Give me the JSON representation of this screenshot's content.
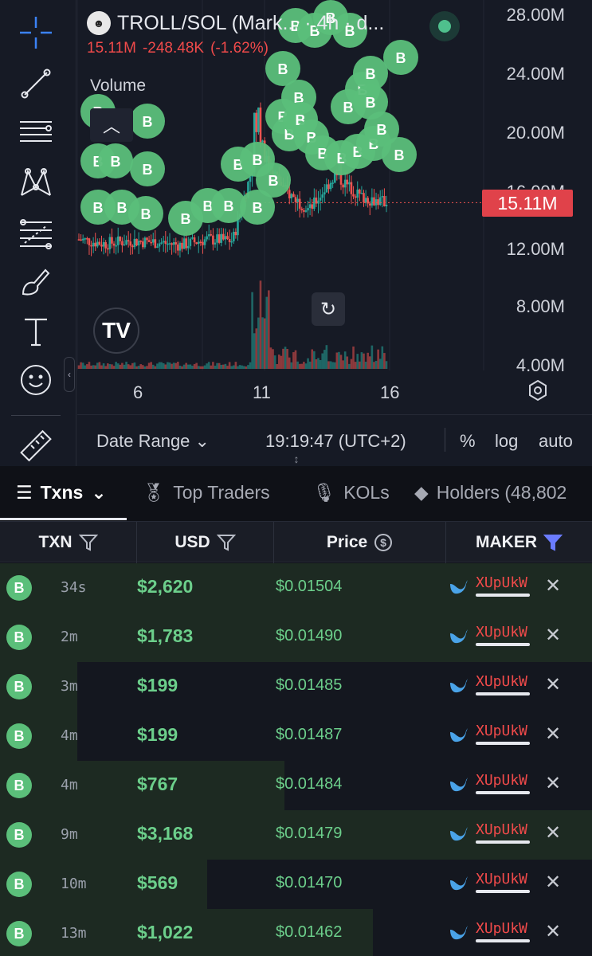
{
  "chart": {
    "pair_title": "TROLL/SOL (Mark... · 4h · d...",
    "coin_icon": "troll-face-icon",
    "last_value": "15.11M",
    "change": "-248.48K",
    "change_pct": "(-1.62%)",
    "volume_label": "Volume",
    "price_tag": "15.11M",
    "y_ticks": [
      "28.00M",
      "24.00M",
      "20.00M",
      "16.00M",
      "12.00M",
      "8.00M",
      "4.00M"
    ],
    "x_ticks": [
      "6",
      "11",
      "16"
    ],
    "bottom_bar": {
      "date_range": "Date Range",
      "clock": "19:19:47 (UTC+2)",
      "pct": "%",
      "log": "log",
      "auto": "auto"
    },
    "colors": {
      "up": "#26a69a",
      "down": "#ef5350",
      "buy_marker": "#5bbf7a",
      "price_tag": "#e0424a"
    },
    "marker_label": "B"
  },
  "chart_data": {
    "type": "candlestick",
    "title": "TROLL/SOL (Mark... · 4h · d...",
    "xlabel": "",
    "ylabel": "",
    "ylim": [
      4000000,
      28000000
    ],
    "x_ticks": [
      "6",
      "11",
      "16"
    ],
    "last": 15110000,
    "approx_series": [
      {
        "x": "4",
        "close": 12600000
      },
      {
        "x": "5",
        "close": 12300000
      },
      {
        "x": "6",
        "close": 12500000
      },
      {
        "x": "7",
        "close": 12400000
      },
      {
        "x": "8",
        "close": 12200000
      },
      {
        "x": "9",
        "close": 12600000
      },
      {
        "x": "10",
        "close": 12500000
      },
      {
        "x": "11",
        "close": 19000000
      },
      {
        "x": "12",
        "close": 16000000
      },
      {
        "x": "13",
        "close": 14600000
      },
      {
        "x": "14",
        "close": 17000000
      },
      {
        "x": "15",
        "close": 15500000
      },
      {
        "x": "16",
        "close": 15110000
      }
    ]
  },
  "tabs": [
    {
      "label": "Txns",
      "icon": "list-icon",
      "active": true
    },
    {
      "label": "Top Traders",
      "icon": "medal-icon",
      "active": false
    },
    {
      "label": "KOLs",
      "icon": "microphone-icon",
      "active": false
    },
    {
      "label": "Holders (48,802",
      "icon": "diamond-icon",
      "active": false
    }
  ],
  "table": {
    "headers": {
      "txn": "TXN",
      "usd": "USD",
      "price": "Price",
      "maker": "MAKER"
    },
    "rows": [
      {
        "type": "B",
        "age": "34s",
        "usd": "$2,620",
        "price": "$0.01504",
        "maker": "XUpUkW",
        "fill": 1.0
      },
      {
        "type": "B",
        "age": "2m",
        "usd": "$1,783",
        "price": "$0.01490",
        "maker": "XUpUkW",
        "fill": 1.0
      },
      {
        "type": "B",
        "age": "3m",
        "usd": "$199",
        "price": "$0.01485",
        "maker": "XUpUkW",
        "fill": 0.13
      },
      {
        "type": "B",
        "age": "4m",
        "usd": "$199",
        "price": "$0.01487",
        "maker": "XUpUkW",
        "fill": 0.13
      },
      {
        "type": "B",
        "age": "4m",
        "usd": "$767",
        "price": "$0.01484",
        "maker": "XUpUkW",
        "fill": 0.48
      },
      {
        "type": "B",
        "age": "9m",
        "usd": "$3,168",
        "price": "$0.01479",
        "maker": "XUpUkW",
        "fill": 1.0
      },
      {
        "type": "B",
        "age": "10m",
        "usd": "$569",
        "price": "$0.01470",
        "maker": "XUpUkW",
        "fill": 0.35
      },
      {
        "type": "B",
        "age": "13m",
        "usd": "$1,022",
        "price": "$0.01462",
        "maker": "XUpUkW",
        "fill": 0.63
      }
    ]
  }
}
